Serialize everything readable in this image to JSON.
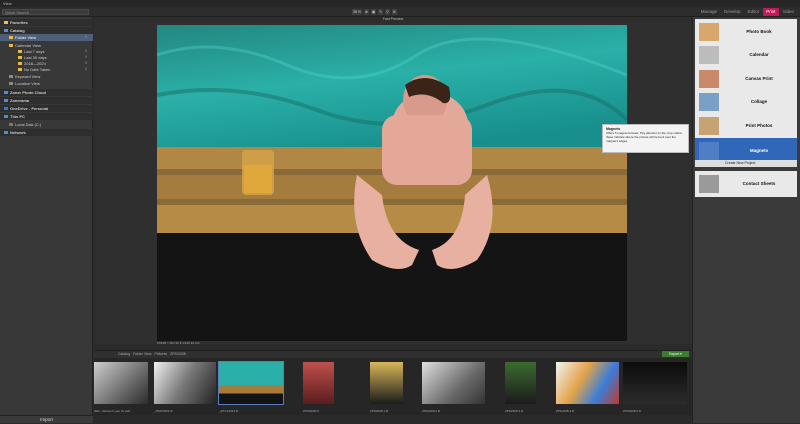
{
  "app": {
    "title": "View"
  },
  "search": {
    "placeholder": "Quick Search"
  },
  "zoom": {
    "value": "38 % ",
    "items": [
      "⊕",
      "▣",
      "✎",
      "⚲",
      "⚙"
    ]
  },
  "modes": [
    "Manage",
    "Develop",
    "Editor",
    "Print",
    "Video"
  ],
  "sidebar": {
    "items": [
      {
        "label": "Favorites",
        "section": true,
        "count": ""
      },
      {
        "label": "Catalog",
        "section": true,
        "count": ""
      },
      {
        "label": "Folder View",
        "selected": true,
        "count": "0"
      },
      {
        "label": "Calendar View",
        "count": ""
      },
      {
        "label": "Last 7 days",
        "count": "0"
      },
      {
        "label": "Last 30 days",
        "count": "0"
      },
      {
        "label": "2018—2024",
        "count": "0"
      },
      {
        "label": "No Date Taken",
        "count": "0"
      },
      {
        "label": "Keyword View",
        "count": ""
      },
      {
        "label": "Location View",
        "count": ""
      },
      {
        "label": "Zoner Photo Cloud",
        "section": true,
        "count": ""
      },
      {
        "label": "Zonerama",
        "section": true,
        "count": ""
      },
      {
        "label": "OneDrive - Personal",
        "section": true,
        "count": ""
      },
      {
        "label": "This PC",
        "section": true,
        "count": ""
      },
      {
        "label": "Local Disk (C:)",
        "count": ""
      },
      {
        "label": "Network",
        "section": true,
        "count": ""
      }
    ],
    "import_label": "Import"
  },
  "viewer": {
    "title": "Fast Preview",
    "info": "5784/6 ×  ISO   f/2.8   1/125   24 mm"
  },
  "filmstrip": {
    "crumbs": [
      "Catalog",
      "Folder View",
      "Pictures",
      "ZPS/2008"
    ],
    "export_label": "Export ▾",
    "labels": [
      "IMG - Retouch your fix web",
      "_P9237823.tif",
      "_ETC12342.tif",
      "ZPS2408.tif",
      "ZPS2408.1.tif",
      "ZPS2408.2.tif",
      "ZPS2408.3.tif",
      "ZPS2408.4.tif",
      "ZPS2408.5.tif"
    ]
  },
  "print_panel": {
    "cards": [
      {
        "label": "Photo Book",
        "selected": false
      },
      {
        "label": "Calendar",
        "selected": false
      },
      {
        "label": "Canvas Print",
        "selected": false
      },
      {
        "label": "Collage",
        "selected": false
      },
      {
        "label": "Print Photos",
        "selected": false
      },
      {
        "label": "Magnets",
        "selected": true
      },
      {
        "label": "Contact Sheets",
        "selected": false
      }
    ],
    "new_project_label": "Create New Project"
  },
  "tooltip": {
    "title": "Magnets",
    "body": "Offers 5 magnet formats. Pay attention to the crop marks; these indicate where the picture will be bent over the magnet's edges."
  },
  "colors": {
    "accent": "#c2185b",
    "selection": "#3167b8",
    "export": "#3a7d2e"
  }
}
